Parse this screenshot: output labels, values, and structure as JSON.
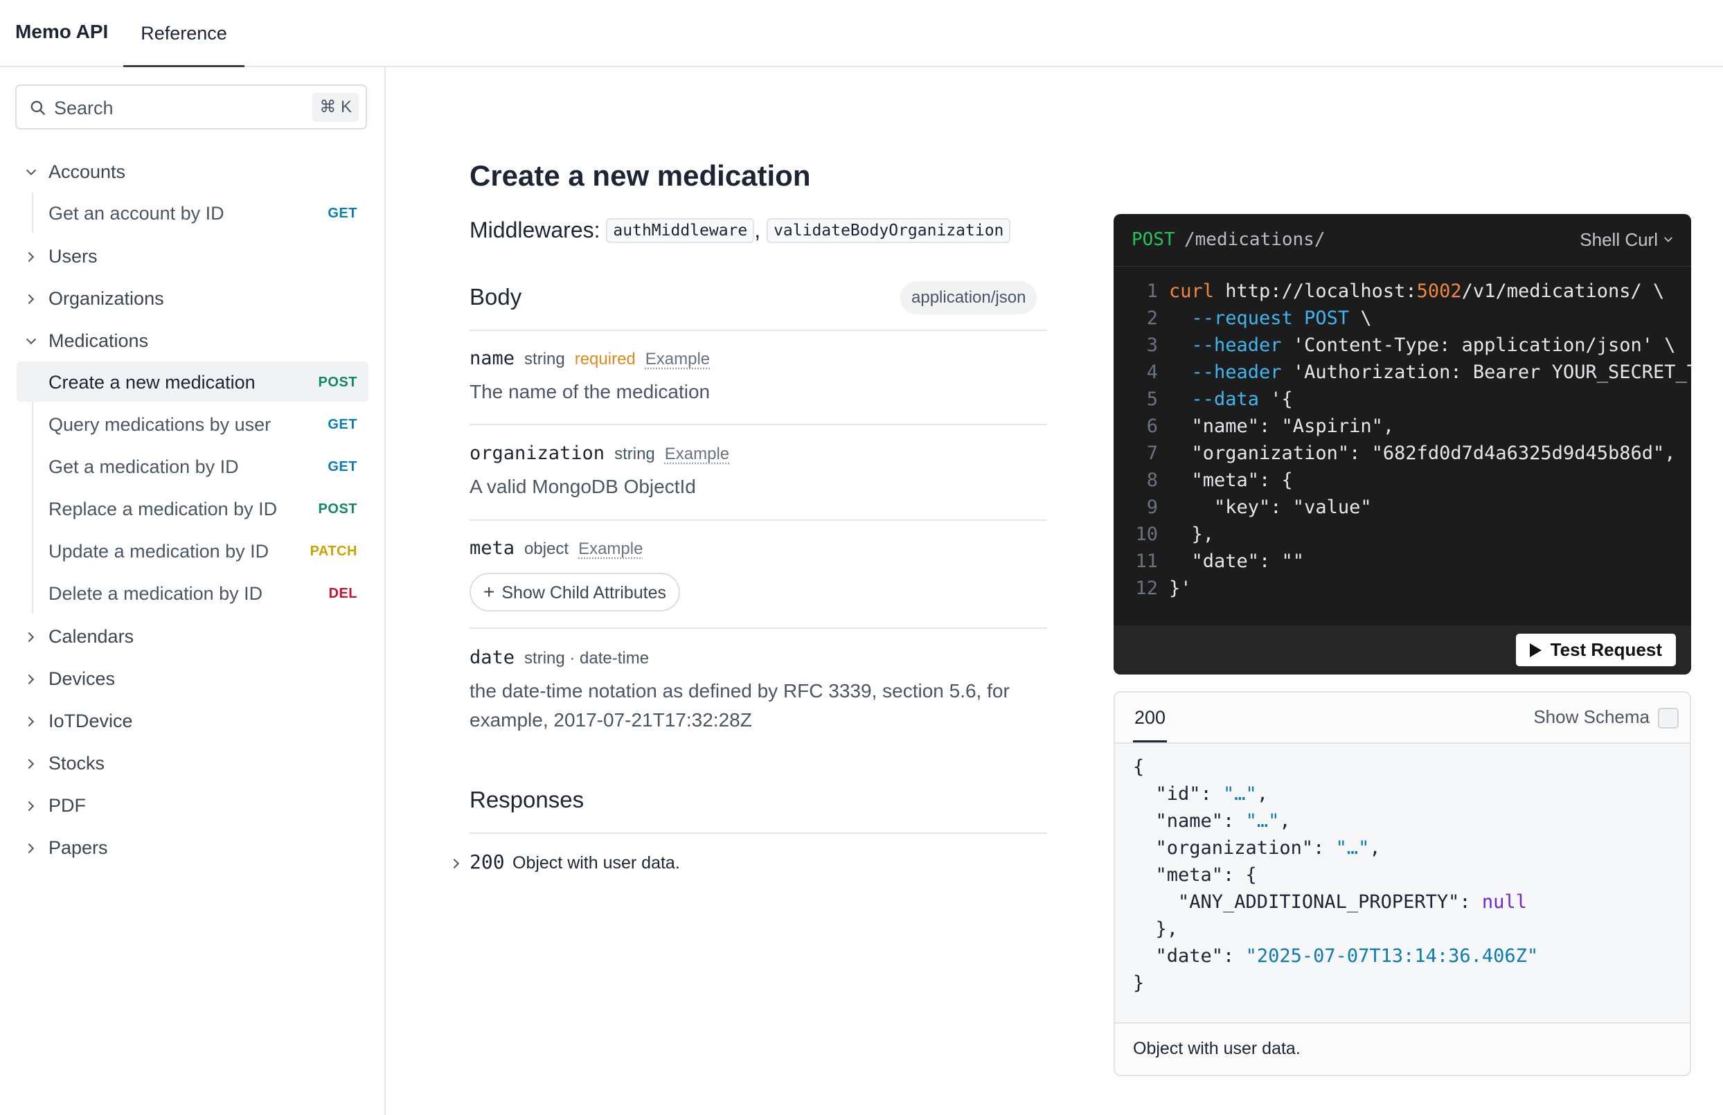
{
  "header": {
    "brand": "Memo API",
    "tab_reference": "Reference"
  },
  "search": {
    "placeholder": "Search",
    "shortcut": "⌘ K"
  },
  "sidebar": {
    "groups": {
      "accounts": "Accounts",
      "users": "Users",
      "organizations": "Organizations",
      "medications": "Medications",
      "calendars": "Calendars",
      "devices": "Devices",
      "iotdevice": "IoTDevice",
      "stocks": "Stocks",
      "pdf": "PDF",
      "papers": "Papers"
    },
    "items": {
      "get_account": {
        "label": "Get an account by ID",
        "method": "GET"
      },
      "create_medication": {
        "label": "Create a new medication",
        "method": "POST"
      },
      "query_medications": {
        "label": "Query medications by user",
        "method": "GET"
      },
      "get_medication": {
        "label": "Get a medication by ID",
        "method": "GET"
      },
      "replace_medication": {
        "label": "Replace a medication by ID",
        "method": "POST"
      },
      "update_medication": {
        "label": "Update a medication by ID",
        "method": "PATCH"
      },
      "delete_medication": {
        "label": "Delete a medication by ID",
        "method": "DEL"
      }
    },
    "method_colors": {
      "GET": "#0b7bb8",
      "POST": "#0f8a5f",
      "PATCH": "#c9a400",
      "DEL": "#c8102e"
    }
  },
  "main": {
    "title": "Create a new medication",
    "middlewares_label": "Middlewares:",
    "middlewares": [
      "authMiddleware",
      "validateBodyOrganization"
    ],
    "middleware_separator": ",",
    "body_title": "Body",
    "content_type": "application/json",
    "params": [
      {
        "name": "name",
        "type": "string",
        "required": "required",
        "example": "Example",
        "description": "The name of the medication"
      },
      {
        "name": "organization",
        "type": "string",
        "example": "Example",
        "description": "A valid MongoDB ObjectId"
      },
      {
        "name": "meta",
        "type": "object",
        "example": "Example",
        "child_button": "Show Child Attributes"
      },
      {
        "name": "date",
        "type": "string · date-time",
        "description": "the date-time notation as defined by RFC 3339, section 5.6, for example, 2017-07-21T17:32:28Z"
      }
    ],
    "responses_title": "Responses",
    "response": {
      "code": "200",
      "description": "Object with user data."
    }
  },
  "request_panel": {
    "method": "POST",
    "path": "/medications/",
    "language": "Shell Curl",
    "line_numbers": [
      "1",
      "2",
      "3",
      "4",
      "5",
      "6",
      "7",
      "8",
      "9",
      "10",
      "11",
      "12"
    ],
    "code": {
      "l1_cmd": "curl",
      "l1_url_a": " http://localhost:",
      "l1_port": "5002",
      "l1_url_b": "/v1/medications/ \\",
      "l2_flag": "  --request",
      "l2_val": " POST",
      "l2_tail": " \\",
      "l3_flag": "  --header",
      "l3_val": " 'Content-Type: application/json' \\",
      "l4_flag": "  --header",
      "l4_val": " 'Authorization: Bearer YOUR_SECRET_TOKEN' \\",
      "l5_flag": "  --data",
      "l5_val": " '{",
      "l6": "  \"name\": \"Aspirin\",",
      "l7": "  \"organization\": \"682fd0d7d4a6325d9d45b86d\",",
      "l8": "  \"meta\": {",
      "l9": "    \"key\": \"value\"",
      "l10": "  },",
      "l11": "  \"date\": \"\"",
      "l12": "}'"
    },
    "test_button": "Test Request"
  },
  "response_panel": {
    "tab": "200",
    "show_schema": "Show Schema",
    "json": {
      "open": "{",
      "id_key": "  \"id\": ",
      "id_val": "\"…\"",
      "name_key": "  \"name\": ",
      "name_val": "\"…\"",
      "org_key": "  \"organization\": ",
      "org_val": "\"…\"",
      "meta_open": "  \"meta\": {",
      "extra_key": "    \"ANY_ADDITIONAL_PROPERTY\": ",
      "extra_val": "null",
      "meta_close": "  },",
      "date_key": "  \"date\": ",
      "date_val": "\"2025-07-07T13:14:36.406Z\"",
      "close": "}",
      "comma": ","
    },
    "footer": "Object with user data."
  }
}
